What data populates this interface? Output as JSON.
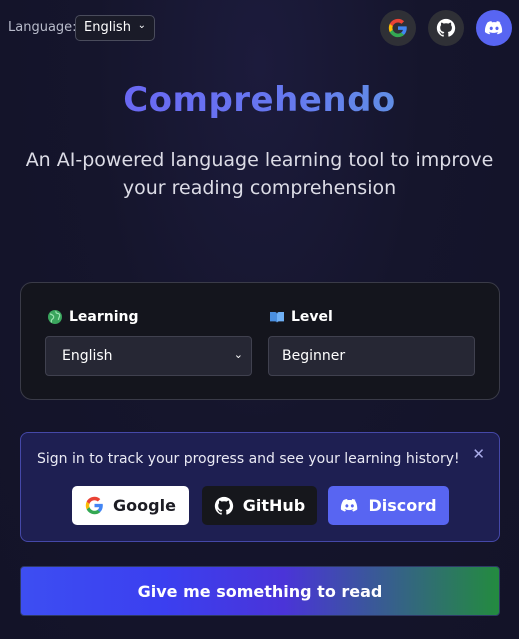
{
  "topbar": {
    "language_label": "Language:",
    "language_value": "English",
    "icons": [
      "google-icon",
      "github-icon",
      "discord-icon"
    ]
  },
  "hero": {
    "title": "Comprehendo",
    "subtitle_line1": "An AI-powered language learning tool to improve",
    "subtitle_line2": "your reading comprehension"
  },
  "settings": {
    "learning_label": "Learning",
    "learning_value": "English",
    "level_label": "Level",
    "level_value": "Beginner"
  },
  "signin": {
    "message": "Sign in to track your progress and see your learning history!",
    "google_label": "Google",
    "github_label": "GitHub",
    "discord_label": "Discord"
  },
  "cta": {
    "label": "Give me something to read"
  },
  "colors": {
    "accent": "#5865f2",
    "title_gradient_start": "#6d5cf5",
    "title_gradient_end": "#5ba6d8",
    "cta_gradient_end": "#238b3f"
  }
}
